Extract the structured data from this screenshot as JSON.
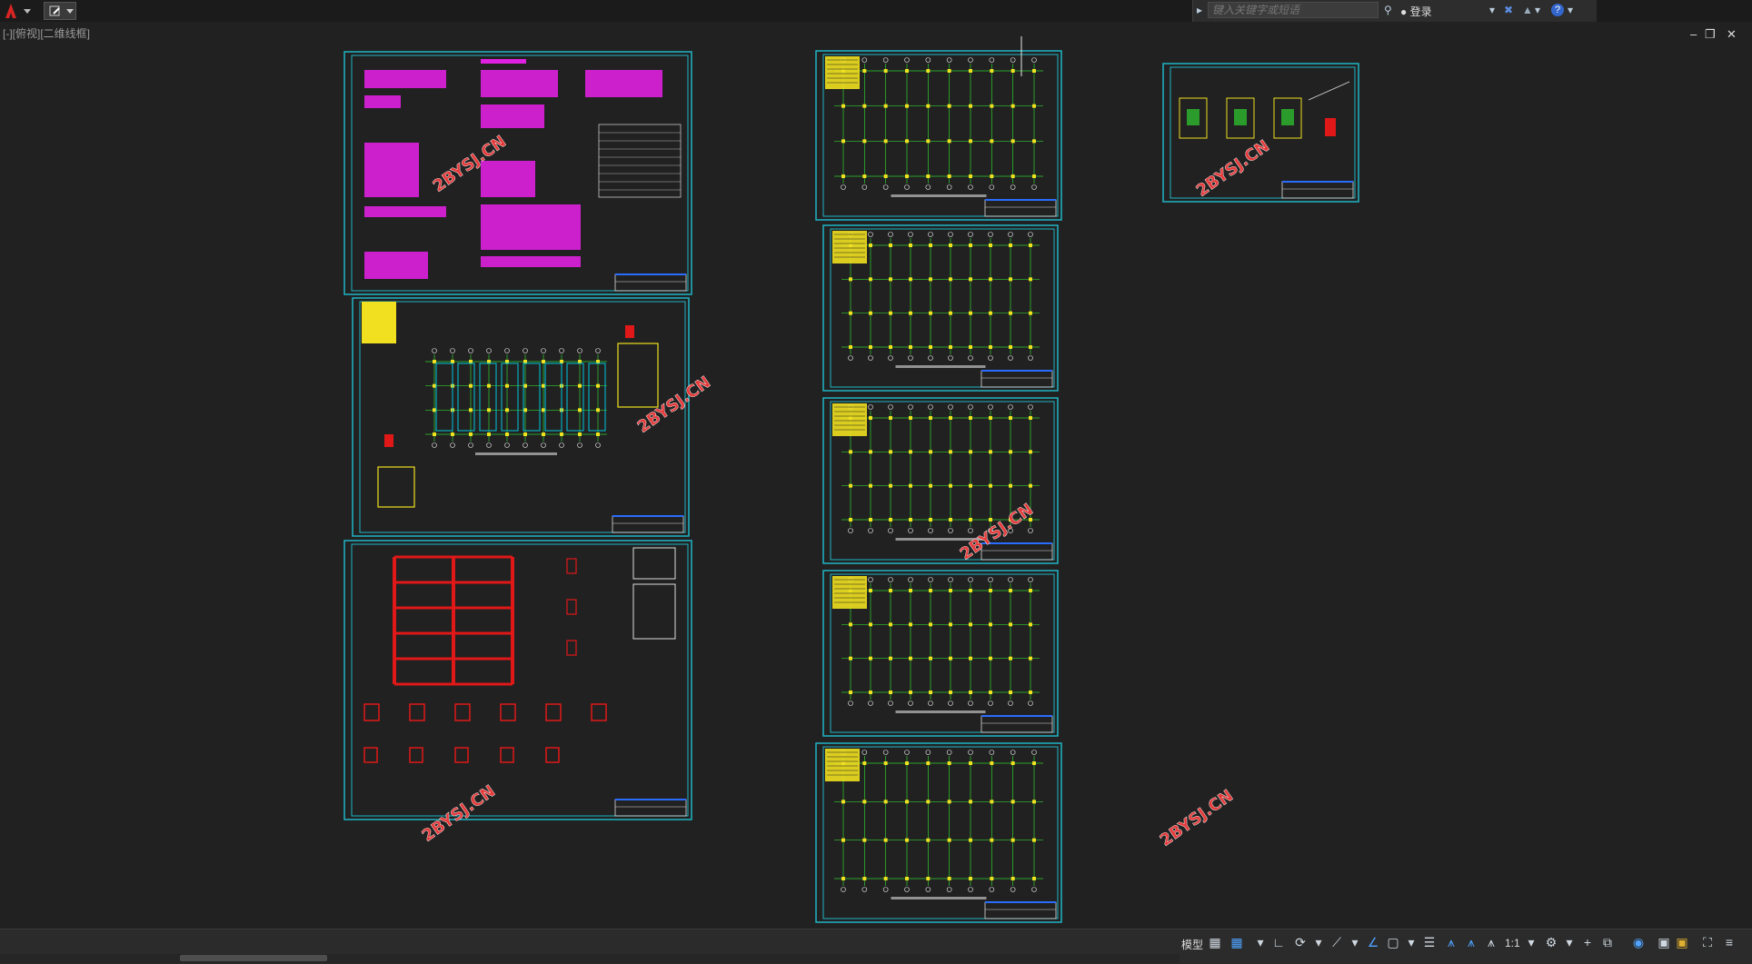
{
  "topbar": {
    "search_placeholder": "键入关键字或短语",
    "login_label": "登录",
    "help_label": "?"
  },
  "viewport_label": "[-][俯视][二维线框]",
  "window_controls": {
    "minimize": "–",
    "restore": "❐",
    "close": "✕"
  },
  "watermark": "2BYSJ.CN",
  "statusbar": {
    "model_label": "模型",
    "scale_label": "1:1"
  },
  "colors": {
    "background": "#212121",
    "frame": "#1fb5c5",
    "notes": "#e020e0",
    "grid_line": "#30d030",
    "beam": "#00c8e0",
    "rebar": "#e01818",
    "highlight": "#f0e020",
    "watermark": "#e63a3a"
  }
}
